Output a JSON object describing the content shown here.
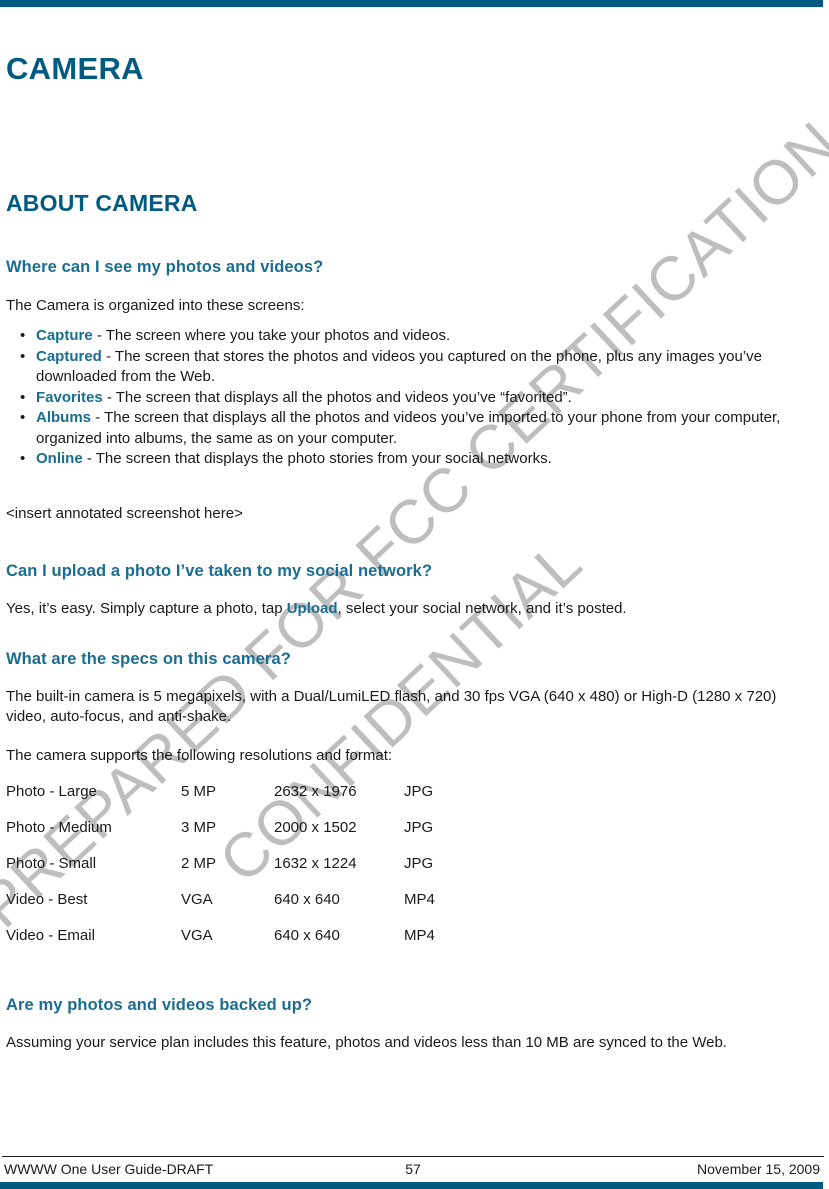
{
  "document": {
    "chapter_title": "CAMERA",
    "section_title": "ABOUT CAMERA"
  },
  "watermark": {
    "line1": "PREPARED FOR FCC CERTIFICATION",
    "line2": "CONFIDENTIAL",
    "color": "#b9b9b9"
  },
  "colors": {
    "accent_bar": "#015a80",
    "heading": "#015a80",
    "subheading": "#1a6d8f",
    "body": "#1a1a1a"
  },
  "qa": {
    "q1": {
      "heading": "Where can I see my photos and videos?",
      "intro": "The Camera is organized into these screens:",
      "items": [
        {
          "term": "Capture",
          "desc": " - The screen where you take your photos and videos."
        },
        {
          "term": "Captured",
          "desc": " - The screen that stores the photos and videos you captured on the phone, plus any images you’ve downloaded from the Web."
        },
        {
          "term": "Favorites",
          "desc": " - The screen that displays all the photos and videos you’ve “favorited”."
        },
        {
          "term": "Albums",
          "desc": " - The screen that displays all the photos and videos you’ve imported to your phone from your computer, organized into albums, the same as on your computer."
        },
        {
          "term": "Online",
          "desc": " - The screen that displays the photo stories from your social networks."
        }
      ],
      "placeholder_note": "<insert annotated screenshot here>"
    },
    "q2": {
      "heading": "Can I upload a photo I’ve taken to my social network?",
      "answer_before": "Yes, it’s easy. Simply capture a photo, tap ",
      "answer_link": "Upload",
      "answer_after": ", select your social network, and it’s posted."
    },
    "q3": {
      "heading": "What are the specs on this camera?",
      "paragraph": "The built-in camera is 5 megapixels, with a Dual/LumiLED flash, and 30 fps VGA (640 x 480) or High-D (1280 x 720) video, auto-focus, and anti-shake.",
      "table_intro": "The camera supports the following resolutions and format:",
      "table_rows": [
        {
          "label": "Photo - Large",
          "mp": "5 MP",
          "resolution": "2632 x 1976",
          "format": "JPG"
        },
        {
          "label": "Photo - Medium",
          "mp": "3 MP",
          "resolution": "2000 x 1502",
          "format": "JPG"
        },
        {
          "label": "Photo - Small",
          "mp": "2 MP",
          "resolution": "1632 x 1224",
          "format": "JPG"
        },
        {
          "label": "Video - Best",
          "mp": "VGA",
          "resolution": "640 x 640",
          "format": "MP4"
        },
        {
          "label": "Video - Email",
          "mp": "VGA",
          "resolution": "640 x 640",
          "format": "MP4"
        }
      ]
    },
    "q4": {
      "heading": "Are my photos and videos backed up?",
      "paragraph": "Assuming your service plan includes this feature, photos and videos less than 10 MB are synced to the Web."
    }
  },
  "footer": {
    "left": "WWWW One User Guide-DRAFT",
    "page_number": "57",
    "right": "November 15, 2009"
  }
}
